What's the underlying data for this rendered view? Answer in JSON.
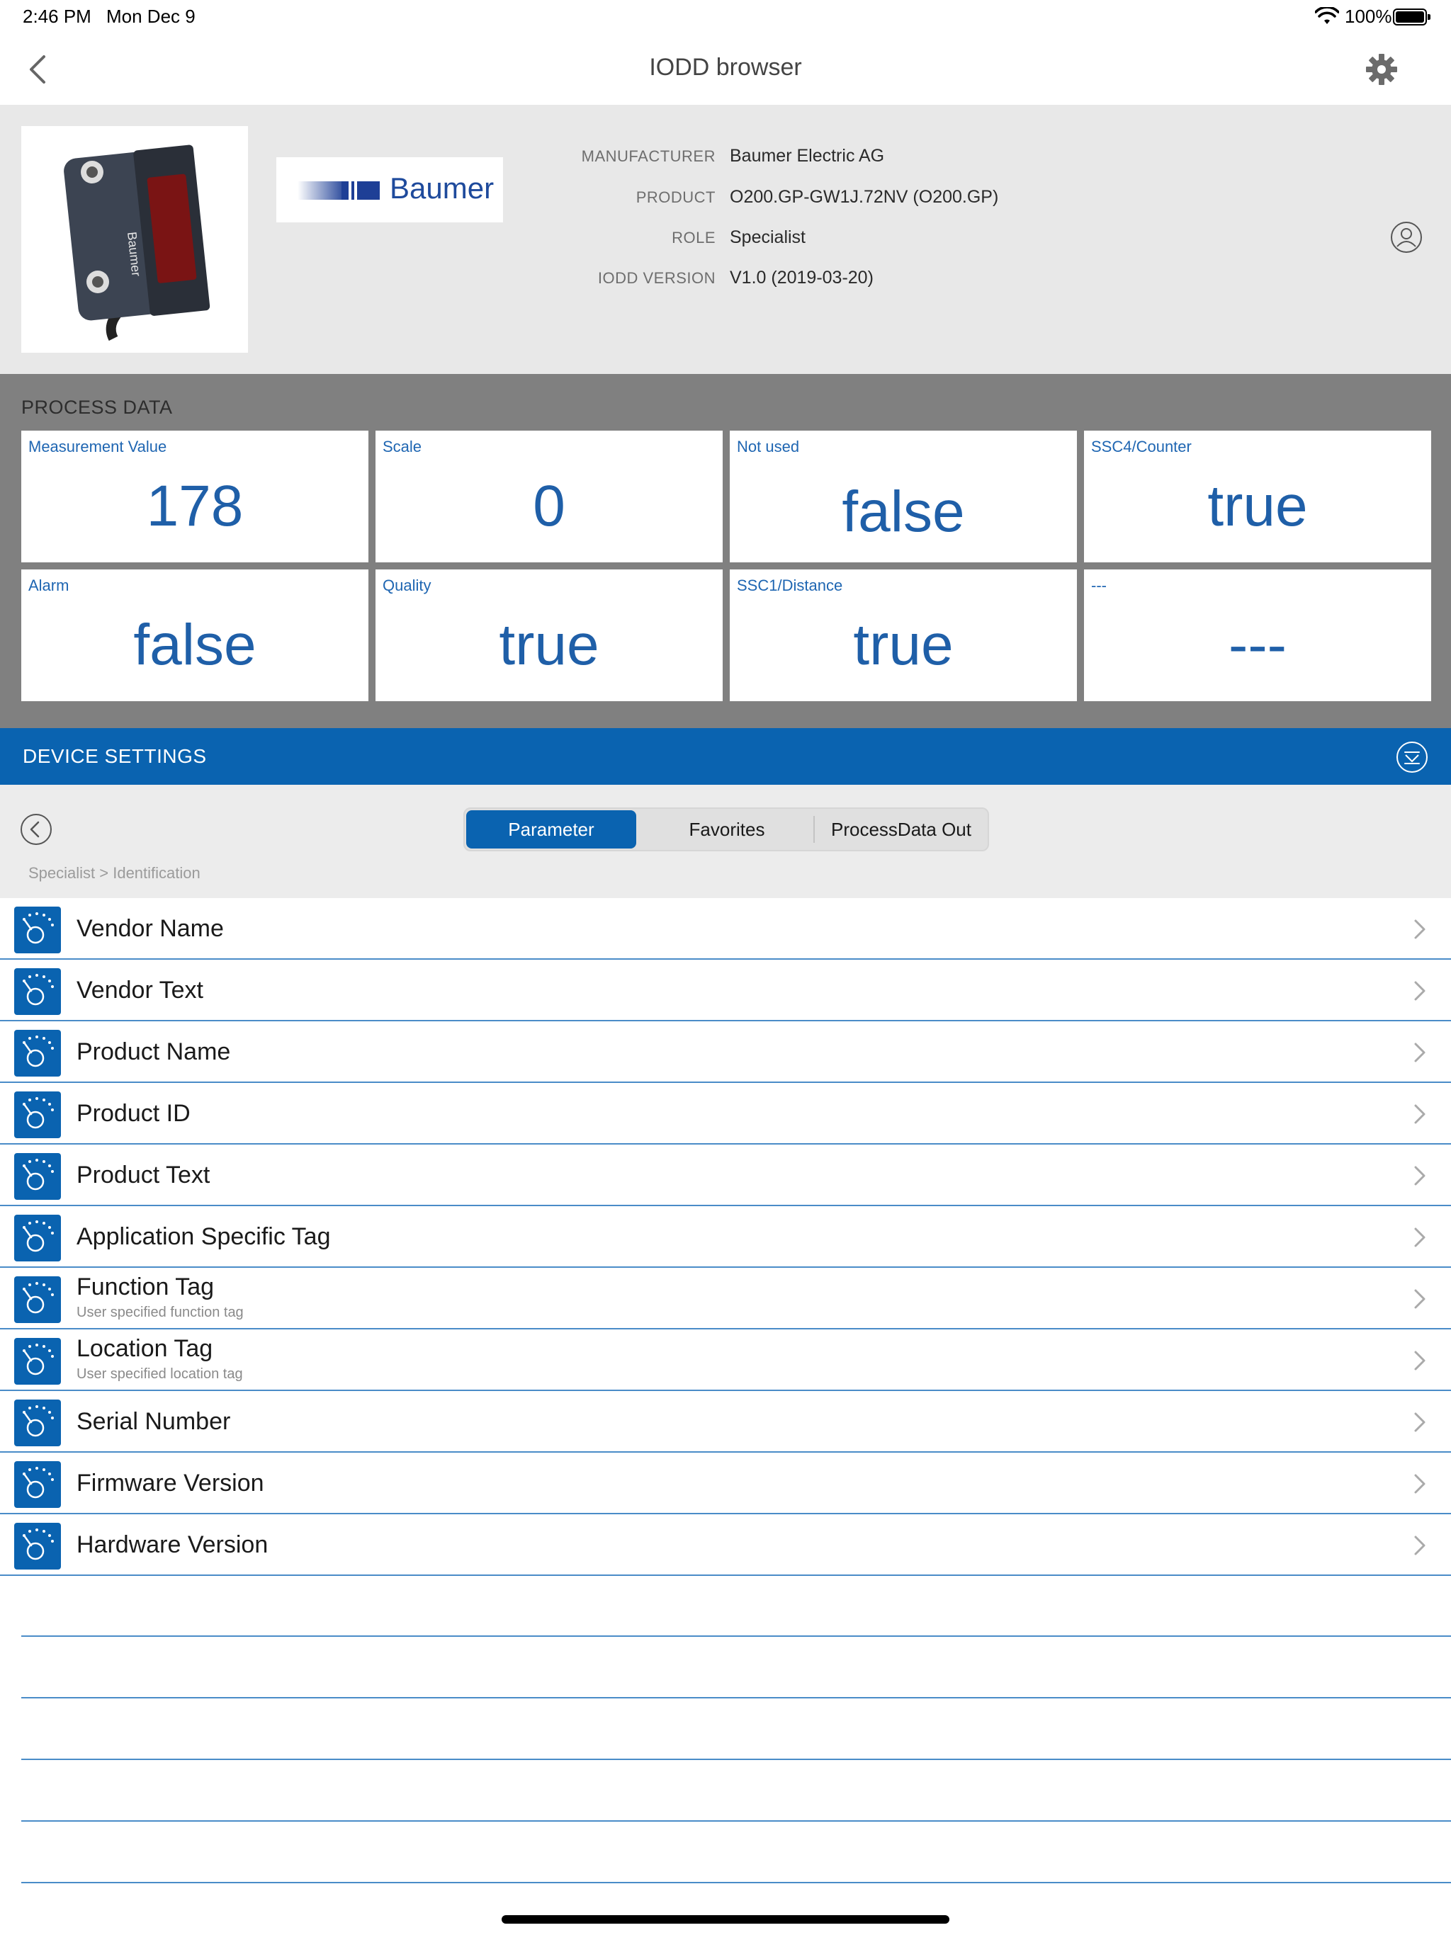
{
  "status_bar": {
    "time": "2:46 PM",
    "date": "Mon Dec 9",
    "battery": "100%"
  },
  "nav": {
    "title": "IODD browser"
  },
  "device": {
    "logo": "Baumer",
    "info": [
      {
        "key": "MANUFACTURER",
        "value": "Baumer Electric AG"
      },
      {
        "key": "PRODUCT",
        "value": "O200.GP-GW1J.72NV (O200.GP)"
      },
      {
        "key": "ROLE",
        "value": "Specialist"
      },
      {
        "key": "IODD VERSION",
        "value": "V1.0 (2019-03-20)"
      }
    ]
  },
  "process_data": {
    "heading": "PROCESS DATA",
    "tiles": [
      {
        "label": "Measurement Value",
        "value": "178"
      },
      {
        "label": "Scale",
        "value": "0"
      },
      {
        "label": "Not used",
        "value": "false"
      },
      {
        "label": "SSC4/Counter",
        "value": "true"
      },
      {
        "label": "Alarm",
        "value": "false"
      },
      {
        "label": "Quality",
        "value": "true"
      },
      {
        "label": "SSC1/Distance",
        "value": "true"
      },
      {
        "label": "---",
        "value": "---"
      }
    ]
  },
  "settings": {
    "heading": "DEVICE SETTINGS",
    "tabs": [
      "Parameter",
      "Favorites",
      "ProcessData Out"
    ],
    "active_tab": "Parameter",
    "breadcrumb": "Specialist > Identification"
  },
  "parameters": [
    {
      "title": "Vendor Name",
      "subtitle": ""
    },
    {
      "title": "Vendor Text",
      "subtitle": ""
    },
    {
      "title": "Product Name",
      "subtitle": ""
    },
    {
      "title": "Product ID",
      "subtitle": ""
    },
    {
      "title": "Product Text",
      "subtitle": ""
    },
    {
      "title": "Application Specific Tag",
      "subtitle": ""
    },
    {
      "title": "Function Tag",
      "subtitle": "User specified function tag"
    },
    {
      "title": "Location Tag",
      "subtitle": "User specified location tag"
    },
    {
      "title": "Serial Number",
      "subtitle": ""
    },
    {
      "title": "Firmware Version",
      "subtitle": ""
    },
    {
      "title": "Hardware Version",
      "subtitle": ""
    }
  ],
  "colors": {
    "accent": "#0a63b0",
    "tile_value": "#1f5fa8",
    "header_bg": "#e8e8e8",
    "process_bg": "#808080"
  },
  "icons": [
    "chevron-left-icon",
    "gear-icon",
    "user-icon",
    "collapse-icon",
    "parameter-dial-icon",
    "chevron-right-icon",
    "wifi-icon",
    "battery-icon"
  ]
}
